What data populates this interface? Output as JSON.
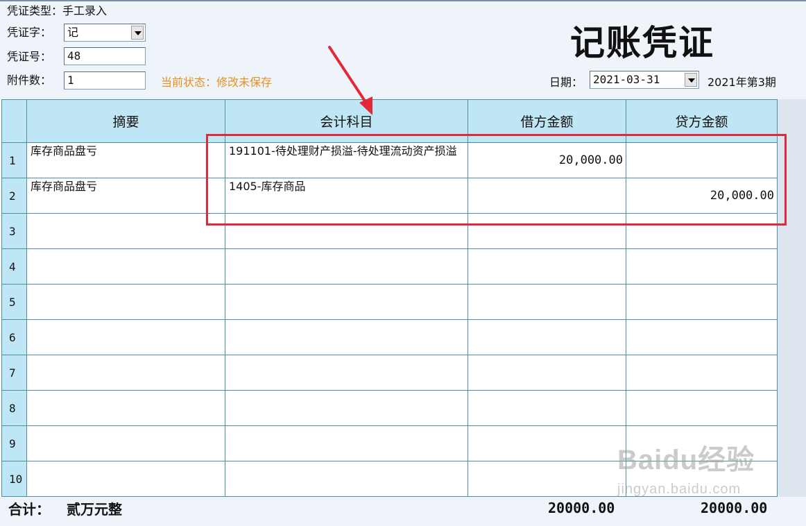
{
  "header": {
    "voucher_type_label": "凭证类型：",
    "voucher_type_value": "手工录入",
    "voucher_word_label": "凭证字：",
    "voucher_word_value": "记",
    "voucher_no_label": "凭证号：",
    "voucher_no_value": "48",
    "attachments_label": "附件数：",
    "attachments_value": "1",
    "status_text": "当前状态：修改未保存",
    "title": "记账凭证",
    "date_label": "日期：",
    "date_value": "2021-03-31",
    "period_text": "2021年第3期"
  },
  "table": {
    "columns": [
      "摘要",
      "会计科目",
      "借方金额",
      "贷方金额"
    ],
    "rows": [
      {
        "num": "1",
        "summary": "库存商品盘亏",
        "account": "191101-待处理财产损溢-待处理流动资产损溢",
        "debit": "20,000.00",
        "credit": ""
      },
      {
        "num": "2",
        "summary": "库存商品盘亏",
        "account": "1405-库存商品",
        "debit": "",
        "credit": "20,000.00"
      },
      {
        "num": "3",
        "summary": "",
        "account": "",
        "debit": "",
        "credit": ""
      },
      {
        "num": "4",
        "summary": "",
        "account": "",
        "debit": "",
        "credit": ""
      },
      {
        "num": "5",
        "summary": "",
        "account": "",
        "debit": "",
        "credit": ""
      },
      {
        "num": "6",
        "summary": "",
        "account": "",
        "debit": "",
        "credit": ""
      },
      {
        "num": "7",
        "summary": "",
        "account": "",
        "debit": "",
        "credit": ""
      },
      {
        "num": "8",
        "summary": "",
        "account": "",
        "debit": "",
        "credit": ""
      },
      {
        "num": "9",
        "summary": "",
        "account": "",
        "debit": "",
        "credit": ""
      },
      {
        "num": "10",
        "summary": "",
        "account": "",
        "debit": "",
        "credit": ""
      }
    ]
  },
  "footer": {
    "total_label": "合计：",
    "total_words": "贰万元整",
    "debit_total": "20000.00",
    "credit_total": "20000.00"
  },
  "annotation": {
    "highlight_color": "#e02a3a"
  },
  "watermark": {
    "brand": "Baidu经验",
    "url": "jingyan.baidu.com"
  }
}
